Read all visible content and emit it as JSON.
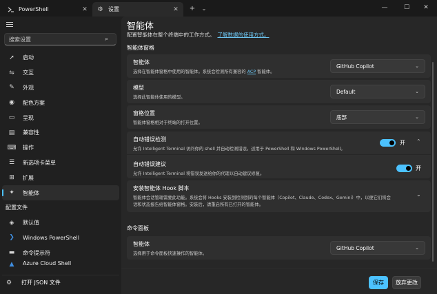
{
  "tabs": [
    {
      "title": "PowerShell",
      "icon": "powershell-icon"
    },
    {
      "title": "设置",
      "icon": "gear-icon"
    }
  ],
  "search": {
    "placeholder": "搜索设置"
  },
  "nav": {
    "items": [
      {
        "label": "启动",
        "icon": "rocket-icon"
      },
      {
        "label": "交互",
        "icon": "interaction-icon"
      },
      {
        "label": "外观",
        "icon": "brush-icon"
      },
      {
        "label": "配色方案",
        "icon": "palette-icon"
      },
      {
        "label": "呈现",
        "icon": "monitor-icon"
      },
      {
        "label": "兼容性",
        "icon": "compat-icon"
      },
      {
        "label": "操作",
        "icon": "keyboard-icon"
      },
      {
        "label": "新选项卡菜单",
        "icon": "new-tab-menu-icon"
      },
      {
        "label": "扩展",
        "icon": "extensions-icon"
      },
      {
        "label": "智能体",
        "icon": "sparkle-icon"
      }
    ],
    "profiles_header": "配置文件",
    "profiles": [
      {
        "label": "默认值",
        "icon": "layers-icon"
      },
      {
        "label": "Windows PowerShell",
        "icon": "powershell-icon"
      },
      {
        "label": "命令提示符",
        "icon": "cmd-icon"
      },
      {
        "label": "Azure Cloud Shell",
        "icon": "azure-icon"
      }
    ],
    "open_json": "打开 JSON 文件"
  },
  "page": {
    "title": "智能体",
    "description": "配置智能体在整个终端中的工作方式。",
    "description_link": "了解数据的使用方式。"
  },
  "sections": {
    "pane": "智能体窗格",
    "palette": "命令面板"
  },
  "settings": {
    "agent": {
      "title": "智能体",
      "sub_before": "选择在智能体窗格中使用的智能体。系统会检测所有兼容的",
      "sub_link": "ACP",
      "sub_after": "智能体。",
      "value": "GitHub Copilot"
    },
    "model": {
      "title": "模型",
      "sub": "选择此智能体使用的模型。",
      "value": "Default"
    },
    "position": {
      "title": "窗格位置",
      "sub": "智能体窗格相对于终端的打开位置。",
      "value": "底部"
    },
    "auto_detect": {
      "title": "自动错误检测",
      "sub": "允许 Intelligent Terminal 访问你的 shell 并自动检测错误。适用于 PowerShell 和 Windows PowerShell。",
      "state": "开"
    },
    "auto_suggest": {
      "title": "自动错误建议",
      "sub": "允许 Intelligent Terminal 将错误发送给你的代理以自动建议修复。",
      "state": "开"
    },
    "hook": {
      "title": "安装智能体 Hook 脚本",
      "sub1": "智能体会话管理需要此功能。系统会将 Hooks 安装到检测到的每个智能体（Copilot、Claude、Codex、Gemini）中，以便它们将会",
      "sub2": "话和状态报告给智能体窗格。安装后，请重启所有已打开的智能体。"
    },
    "palette_agent": {
      "title": "智能体",
      "sub": "选择用于命令面板快速操作的智能体。",
      "value": "GitHub Copilot"
    }
  },
  "footer": {
    "save": "保存",
    "discard": "放弃更改"
  },
  "colors": {
    "accent": "#4cc2ff",
    "background": "#202020",
    "card": "#2f2f2f"
  }
}
